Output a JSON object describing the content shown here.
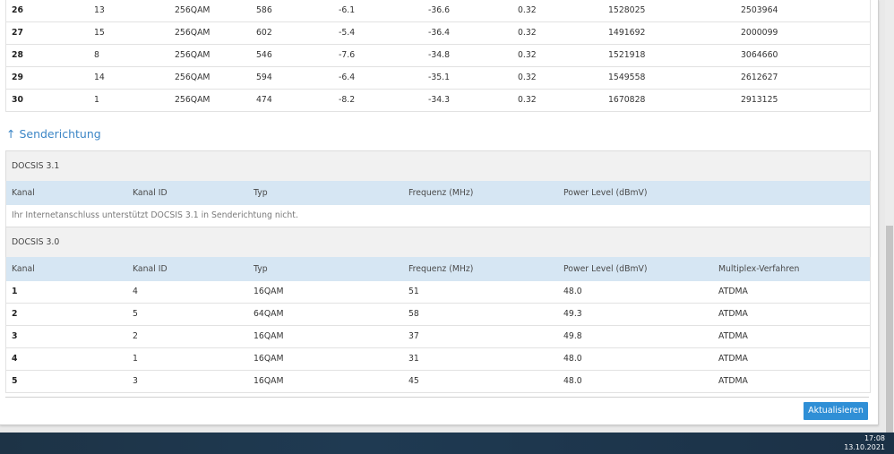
{
  "downstream_rows": [
    [
      "26",
      "13",
      "256QAM",
      "586",
      "-6.1",
      "-36.6",
      "0.32",
      "1528025",
      "2503964"
    ],
    [
      "27",
      "15",
      "256QAM",
      "602",
      "-5.4",
      "-36.4",
      "0.32",
      "1491692",
      "2000099"
    ],
    [
      "28",
      "8",
      "256QAM",
      "546",
      "-7.6",
      "-34.8",
      "0.32",
      "1521918",
      "3064660"
    ],
    [
      "29",
      "14",
      "256QAM",
      "594",
      "-6.4",
      "-35.1",
      "0.32",
      "1549558",
      "2612627"
    ],
    [
      "30",
      "1",
      "256QAM",
      "474",
      "-8.2",
      "-34.3",
      "0.32",
      "1670828",
      "2913125"
    ]
  ],
  "upstream": {
    "link_label": "↑ Senderichtung",
    "docsis31": {
      "title": "DOCSIS 3.1",
      "headers": [
        "Kanal",
        "Kanal ID",
        "Typ",
        "Frequenz (MHz)",
        "Power Level (dBmV)"
      ],
      "message": "Ihr Internetanschluss unterstützt DOCSIS 3.1 in Senderichtung nicht."
    },
    "docsis30": {
      "title": "DOCSIS 3.0",
      "headers": [
        "Kanal",
        "Kanal ID",
        "Typ",
        "Frequenz (MHz)",
        "Power Level (dBmV)",
        "Multiplex-Verfahren"
      ],
      "rows": [
        [
          "1",
          "4",
          "16QAM",
          "51",
          "48.0",
          "ATDMA"
        ],
        [
          "2",
          "5",
          "64QAM",
          "58",
          "49.3",
          "ATDMA"
        ],
        [
          "3",
          "2",
          "16QAM",
          "37",
          "49.8",
          "ATDMA"
        ],
        [
          "4",
          "1",
          "16QAM",
          "31",
          "48.0",
          "ATDMA"
        ],
        [
          "5",
          "3",
          "16QAM",
          "45",
          "48.0",
          "ATDMA"
        ]
      ]
    }
  },
  "button": {
    "refresh": "Aktualisieren"
  },
  "taskbar": {
    "time": "17:08",
    "date": "13.10.2021"
  },
  "colors": {
    "accent": "#2f8fd6",
    "header_bg": "#d6e6f3",
    "link": "#3c86c6"
  }
}
